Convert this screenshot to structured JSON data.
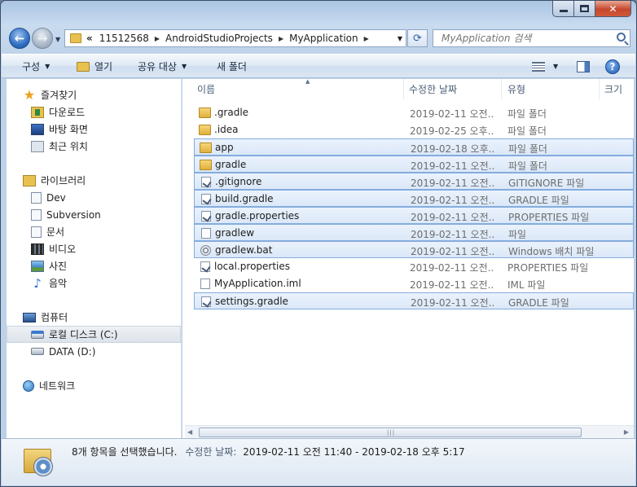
{
  "window": {
    "caption_min": "minimize",
    "caption_max": "maximize",
    "caption_close": "✕"
  },
  "address": {
    "overflow": "«",
    "crumbs": [
      "11512568",
      "AndroidStudioProjects",
      "MyApplication"
    ]
  },
  "search": {
    "placeholder": "MyApplication 검색"
  },
  "toolbar": {
    "organize": "구성",
    "open": "열기",
    "share": "공유 대상",
    "new_folder": "새 폴더"
  },
  "nav": {
    "favorites": "즐겨찾기",
    "downloads": "다운로드",
    "desktop": "바탕 화면",
    "recent": "최근 위치",
    "libraries": "라이브러리",
    "dev": "Dev",
    "subversion": "Subversion",
    "documents": "문서",
    "videos": "비디오",
    "pictures": "사진",
    "music": "음악",
    "computer": "컴퓨터",
    "local_disk": "로컬 디스크 (C:)",
    "data_disk": "DATA (D:)",
    "network": "네트워크"
  },
  "columns": {
    "name": "이름",
    "date": "수정한 날짜",
    "type": "유형",
    "size": "크기"
  },
  "files": [
    {
      "name": ".gradle",
      "date": "2019-02-11 오전...",
      "type": "파일 폴더",
      "icon": "folder",
      "selected": false
    },
    {
      "name": ".idea",
      "date": "2019-02-25 오후...",
      "type": "파일 폴더",
      "icon": "folder",
      "selected": false
    },
    {
      "name": "app",
      "date": "2019-02-18 오후...",
      "type": "파일 폴더",
      "icon": "folder",
      "selected": true
    },
    {
      "name": "gradle",
      "date": "2019-02-11 오전...",
      "type": "파일 폴더",
      "icon": "folder",
      "selected": true
    },
    {
      "name": ".gitignore",
      "date": "2019-02-11 오전...",
      "type": "GITIGNORE 파일",
      "icon": "gradle",
      "selected": true
    },
    {
      "name": "build.gradle",
      "date": "2019-02-11 오전...",
      "type": "GRADLE 파일",
      "icon": "gradle",
      "selected": true
    },
    {
      "name": "gradle.properties",
      "date": "2019-02-11 오전...",
      "type": "PROPERTIES 파일",
      "icon": "gradle",
      "selected": true
    },
    {
      "name": "gradlew",
      "date": "2019-02-11 오전...",
      "type": "파일",
      "icon": "file",
      "selected": true
    },
    {
      "name": "gradlew.bat",
      "date": "2019-02-11 오전...",
      "type": "Windows 배치 파일",
      "icon": "bat",
      "selected": true
    },
    {
      "name": "local.properties",
      "date": "2019-02-11 오전...",
      "type": "PROPERTIES 파일",
      "icon": "gradle",
      "selected": false
    },
    {
      "name": "MyApplication.iml",
      "date": "2019-02-11 오전...",
      "type": "IML 파일",
      "icon": "file",
      "selected": false
    },
    {
      "name": "settings.gradle",
      "date": "2019-02-11 오전...",
      "type": "GRADLE 파일",
      "icon": "gradle",
      "selected": true
    }
  ],
  "details": {
    "summary": "8개 항목을 선택했습니다.",
    "date_label": "수정한 날짜:",
    "date_range": "2019-02-11 오전 11:40 - 2019-02-18 오후 5:17"
  },
  "icons": {
    "back": "back-arrow-icon",
    "forward": "forward-arrow-icon",
    "refresh": "refresh-icon",
    "search": "search-icon",
    "help": "help-icon"
  },
  "colors": {
    "selection_fill": "#dbe8f8",
    "selection_border": "#84acdd",
    "folder": "#e8c14f"
  }
}
